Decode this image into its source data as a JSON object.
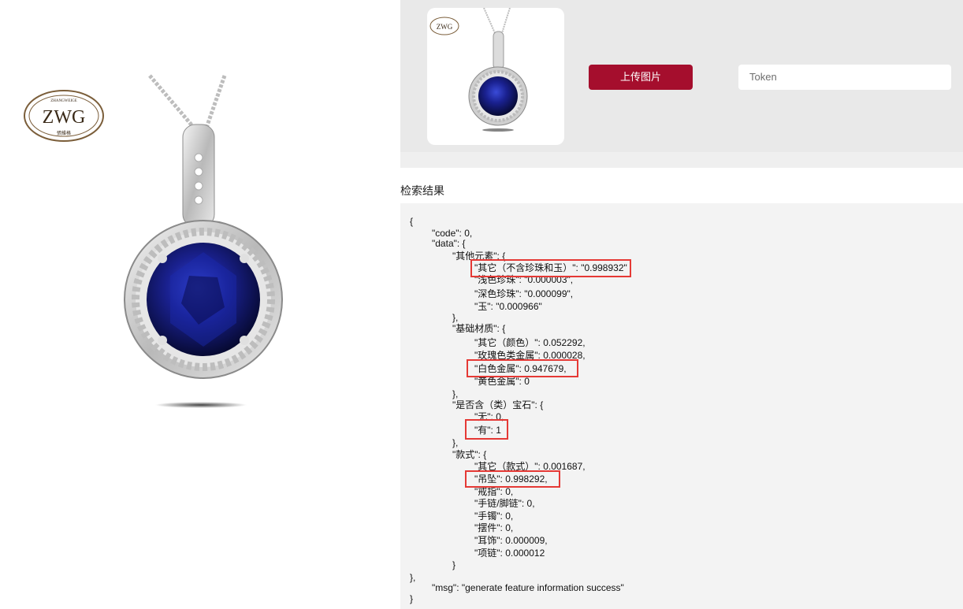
{
  "logo": {
    "brand": "ZWG",
    "arc_left": "ZHANGWEIGE",
    "arc_right": "WORKSHOP",
    "bottom": "張維格"
  },
  "toolbar": {
    "upload_label": "上传图片",
    "token_placeholder": "Token"
  },
  "results": {
    "title": "检索结果"
  },
  "json_lines": [
    "{",
    "\"code\": 0,",
    "\"data\": {",
    "\"其他元素\": {",
    "\"其它（不含珍珠和玉）\": \"0.998932\"",
    "\"浅色珍珠\": \"0.000003\",",
    "\"深色珍珠\": \"0.000099\",",
    "\"玉\": \"0.000966\"",
    "},",
    "\"基础材质\": {",
    "\"其它（颜色）\": 0.052292,",
    "\"玫瑰色类金属\": 0.000028,",
    "\"白色金属\": 0.947679,",
    "\"黄色金属\": 0",
    "},",
    "\"是否含（类）宝石\": {",
    "\"无\": 0,",
    "\"有\": 1",
    "},",
    "\"款式\": {",
    "\"其它（款式）\": 0.001687,",
    "\"吊坠\": 0.998292,",
    "\"戒指\": 0,",
    "\"手链/脚链\": 0,",
    "\"手镯\": 0,",
    "\"摆件\": 0,",
    "\"耳饰\": 0.000009,",
    "\"项链\": 0.000012",
    "}",
    "},",
    "\"msg\": \"generate feature information success\"",
    "}"
  ],
  "colors": {
    "accent": "#a50e2d",
    "highlight": "#e53935",
    "gem": "#1a1f6e",
    "panel": "#e9e9e9"
  }
}
